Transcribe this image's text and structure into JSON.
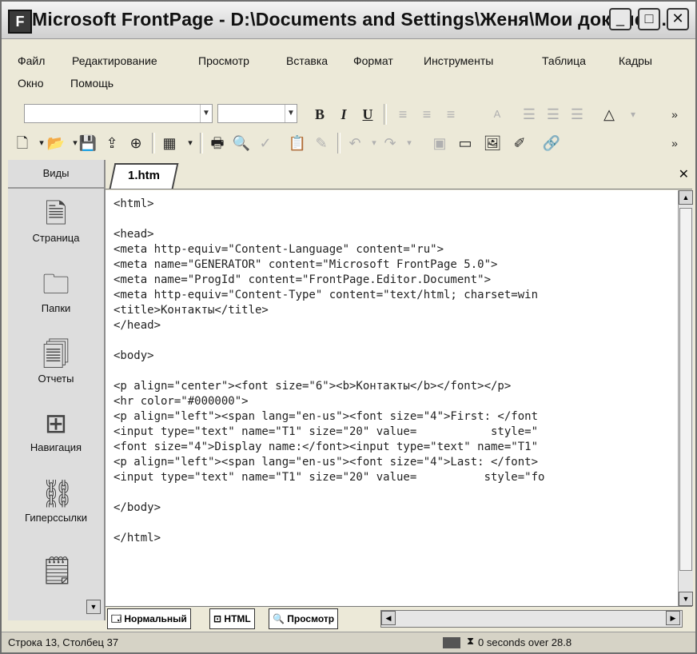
{
  "window": {
    "title": "Microsoft FrontPage - D:\\Documents and Settings\\Женя\\Мои докумен..."
  },
  "menu": {
    "row1": [
      "Файл",
      "Редактирование",
      "Просмотр",
      "Вставка",
      "Формат",
      "Инструменты",
      "Таблица",
      "Кадры"
    ],
    "row2": [
      "Окно",
      "Помощь"
    ]
  },
  "format_toolbar": {
    "bold": "B",
    "italic": "I",
    "underline": "U",
    "font_color_glyph": "A"
  },
  "views": {
    "header": "Виды",
    "items": [
      {
        "label": "Страница",
        "icon": "page-icon"
      },
      {
        "label": "Папки",
        "icon": "folder-icon"
      },
      {
        "label": "Отчеты",
        "icon": "reports-icon"
      },
      {
        "label": "Навигация",
        "icon": "navigation-icon"
      },
      {
        "label": "Гиперссылки",
        "icon": "hyperlinks-icon"
      }
    ]
  },
  "editor": {
    "tab_label": "1.htm",
    "code_lines": [
      "<html>",
      "",
      "<head>",
      "<meta http-equiv=\"Content-Language\" content=\"ru\">",
      "<meta name=\"GENERATOR\" content=\"Microsoft FrontPage 5.0\">",
      "<meta name=\"ProgId\" content=\"FrontPage.Editor.Document\">",
      "<meta http-equiv=\"Content-Type\" content=\"text/html; charset=win",
      "<title>Контакты</title>",
      "</head>",
      "",
      "<body>",
      "",
      "<p align=\"center\"><font size=\"6\"><b>Контакты</b></font></p>",
      "<hr color=\"#000000\">",
      "<p align=\"left\"><span lang=\"en-us\"><font size=\"4\">First: </font",
      "<input type=\"text\" name=\"T1\" size=\"20\" value=           style=\"",
      "<font size=\"4\">Display name:</font><input type=\"text\" name=\"T1\"",
      "<p align=\"left\"><span lang=\"en-us\"><font size=\"4\">Last: </font>",
      "<input type=\"text\" name=\"T1\" size=\"20\" value=          style=\"fo",
      "",
      "</body>",
      "",
      "</html>"
    ]
  },
  "view_tabs": {
    "normal": "Нормальный",
    "html": "HTML",
    "preview": "Просмотр"
  },
  "status": {
    "position": "Строка 13, Столбец 37",
    "download_time": "0 seconds over 28.8"
  }
}
